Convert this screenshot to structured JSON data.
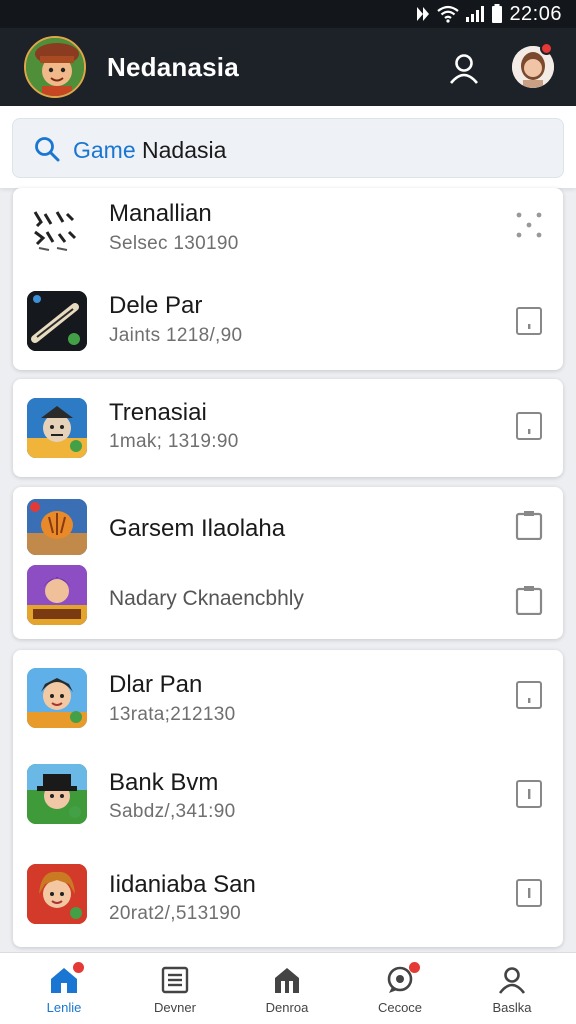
{
  "status_bar": {
    "time": "22:06"
  },
  "app_bar": {
    "title": "Nedanasia"
  },
  "search": {
    "keyword": "Game",
    "query": " Nadasia"
  },
  "cards": [
    {
      "items": [
        {
          "title": "Manallian",
          "subtitle": "Selsec 130190",
          "action_icon": "more-dots-icon"
        },
        {
          "title": "Dele Par",
          "subtitle": "Jaints 1218/,90",
          "action_icon": "bookmark-icon"
        }
      ]
    },
    {
      "items": [
        {
          "title": "Trenasiai",
          "subtitle": "1mak; 1319:90",
          "action_icon": "bookmark-icon"
        }
      ]
    },
    {
      "items": [
        {
          "title": "Garsem Ilaolaha",
          "subtitle": "",
          "action_icon": "clipboard-icon"
        },
        {
          "title": "Nadary Cknaencbhly",
          "subtitle": "",
          "action_icon": "clipboard-icon"
        }
      ]
    },
    {
      "items": [
        {
          "title": "Dlar Pan",
          "subtitle": "13rata;212130",
          "action_icon": "bookmark-icon"
        },
        {
          "title": "Bank Bvm",
          "subtitle": "Sabdz/,341:90",
          "action_icon": "bookmark-icon"
        },
        {
          "title": "Iidaniaba San",
          "subtitle": "20rat2/,513190",
          "action_icon": "bookmark-icon"
        }
      ]
    }
  ],
  "bottom_nav": [
    {
      "label": "Lenlie",
      "icon": "home-icon",
      "active": true,
      "badge": true
    },
    {
      "label": "Devner",
      "icon": "list-icon",
      "active": false,
      "badge": false
    },
    {
      "label": "Denroa",
      "icon": "store-icon",
      "active": false,
      "badge": false
    },
    {
      "label": "Cecoce",
      "icon": "chat-icon",
      "active": false,
      "badge": true
    },
    {
      "label": "Baslka",
      "icon": "person-icon",
      "active": false,
      "badge": false
    }
  ],
  "colors": {
    "appbar": "#1d2228",
    "accent": "#1976d2",
    "badge": "#e53935"
  }
}
